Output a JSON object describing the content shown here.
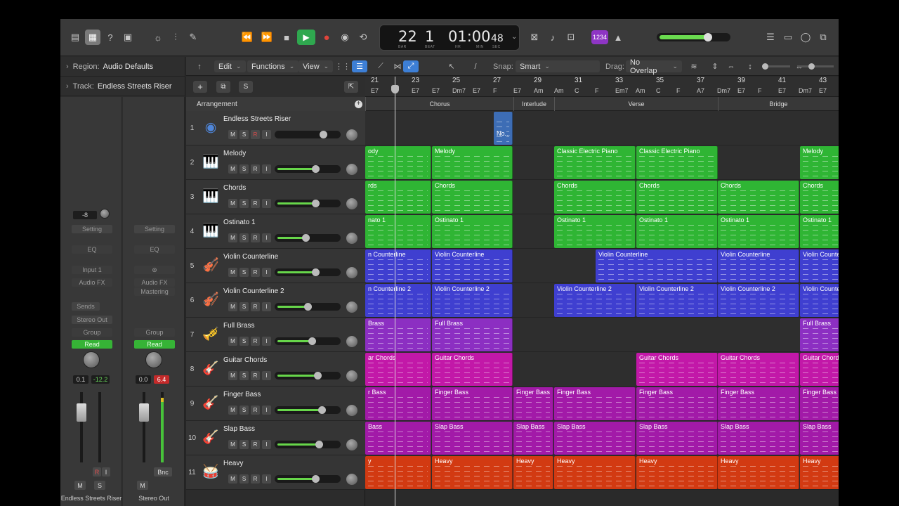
{
  "colors": {
    "green": "#2fb534",
    "blue": "#3f3fd0",
    "purple": "#8c2fc2",
    "magenta": "#c218a8",
    "violet": "#a21aa8",
    "orange": "#d23a12",
    "accent": "#2fa84f"
  },
  "lcd": {
    "bar": "22",
    "beat": "1",
    "time": "01:00",
    "sec": "48",
    "bar_label": "BAR",
    "beat_label": "BEAT",
    "hr": "HR",
    "min": "MIN",
    "sec_label": "SEC"
  },
  "control": {
    "count_in": "1234",
    "rewind_icon": "⏪",
    "ff_icon": "⏩",
    "stop_icon": "■",
    "play_icon": "▶",
    "record_icon": "●",
    "cycle_icon": "⟲"
  },
  "inspector": {
    "region": {
      "label": "Region:",
      "value": "Audio Defaults"
    },
    "track": {
      "label": "Track:",
      "value": "Endless Streets Riser"
    },
    "strip1": {
      "gain": "-8",
      "setting": "Setting",
      "eq": "EQ",
      "input": "Input 1",
      "audio_fx": "Audio FX",
      "sends": "Sends",
      "output": "Stereo Out",
      "group": "Group",
      "read": "Read",
      "vol": "0.1",
      "peak": "-12.2",
      "name": "Endless Streets Riser",
      "m": "M",
      "s": "S",
      "r": "R",
      "i": "I"
    },
    "strip2": {
      "setting": "Setting",
      "eq": "EQ",
      "audio_fx": "Audio FX",
      "mastering": "Mastering",
      "group": "Group",
      "read": "Read",
      "vol": "0.0",
      "peak": "6.4",
      "name": "Stereo Out",
      "m": "M",
      "bnc": "Bnc"
    }
  },
  "toolbar": {
    "edit": "Edit",
    "functions": "Functions",
    "view": "View",
    "snap_label": "Snap:",
    "snap_value": "Smart",
    "drag_label": "Drag:",
    "drag_value": "No Overlap"
  },
  "arrangement_label": "Arrangement",
  "track_buttons": {
    "m": "M",
    "s": "S",
    "r": "R",
    "i": "I"
  },
  "tracks": [
    {
      "num": "1",
      "name": "Endless Streets Riser",
      "icon": "◉",
      "vol": 0.0,
      "armed": true
    },
    {
      "num": "2",
      "name": "Melody",
      "icon": "🎹",
      "vol": 0.66
    },
    {
      "num": "3",
      "name": "Chords",
      "icon": "🎹",
      "vol": 0.66
    },
    {
      "num": "4",
      "name": "Ostinato 1",
      "icon": "🎹",
      "vol": 0.49
    },
    {
      "num": "5",
      "name": "Violin Counterline",
      "icon": "🎻",
      "vol": 0.66
    },
    {
      "num": "6",
      "name": "Violin Counterline 2",
      "icon": "🎻",
      "vol": 0.53
    },
    {
      "num": "7",
      "name": "Full Brass",
      "icon": "🎺",
      "vol": 0.6
    },
    {
      "num": "8",
      "name": "Guitar Chords",
      "icon": "🎸",
      "vol": 0.7
    },
    {
      "num": "9",
      "name": "Finger Bass",
      "icon": "🎸",
      "vol": 0.78
    },
    {
      "num": "10",
      "name": "Slap Bass",
      "icon": "🎸",
      "vol": 0.73
    },
    {
      "num": "11",
      "name": "Heavy",
      "icon": "🥁",
      "vol": 0.66
    }
  ],
  "ruler": {
    "bars": [
      "21",
      "23",
      "25",
      "27",
      "29",
      "31",
      "33",
      "35",
      "37",
      "39",
      "41",
      "43"
    ],
    "chords": [
      "E7",
      "E7",
      "E7",
      "Dm7",
      "E7",
      "F",
      "E7",
      "Am",
      "Am",
      "C",
      "F",
      "Em7",
      "Am",
      "C",
      "F",
      "A7",
      "Dm7",
      "E7",
      "F",
      "E7",
      "Dm7",
      "E7"
    ]
  },
  "markers": [
    "Chorus",
    "Interlude",
    "Verse",
    "Bridge"
  ],
  "regions": [
    {
      "track": 1,
      "name": "No...",
      "kind": "audio"
    },
    {
      "track": 2,
      "name": "ody"
    },
    {
      "track": 2,
      "name": "Melody"
    },
    {
      "track": 2,
      "name": "Classic Electric Piano"
    },
    {
      "track": 2,
      "name": "Classic Electric Piano"
    },
    {
      "track": 2,
      "name": "Melody"
    },
    {
      "track": 3,
      "name": "rds"
    },
    {
      "track": 3,
      "name": "Chords"
    },
    {
      "track": 3,
      "name": "Chords"
    },
    {
      "track": 3,
      "name": "Chords"
    },
    {
      "track": 3,
      "name": "Chords"
    },
    {
      "track": 3,
      "name": "Chords"
    },
    {
      "track": 4,
      "name": "nato 1"
    },
    {
      "track": 4,
      "name": "Ostinato 1"
    },
    {
      "track": 4,
      "name": "Ostinato 1"
    },
    {
      "track": 4,
      "name": "Ostinato 1"
    },
    {
      "track": 4,
      "name": "Ostinato 1"
    },
    {
      "track": 4,
      "name": "Ostinato 1"
    },
    {
      "track": 5,
      "name": "n Counterline"
    },
    {
      "track": 5,
      "name": "Violin Counterline"
    },
    {
      "track": 5,
      "name": "Violin Counterline"
    },
    {
      "track": 5,
      "name": "Violin Counterline"
    },
    {
      "track": 5,
      "name": "Violin Counte"
    },
    {
      "track": 6,
      "name": "n Counterline 2"
    },
    {
      "track": 6,
      "name": "Violin Counterline 2"
    },
    {
      "track": 6,
      "name": "Violin Counterline 2"
    },
    {
      "track": 6,
      "name": "Violin Counterline 2"
    },
    {
      "track": 6,
      "name": "Violin Counterline 2"
    },
    {
      "track": 6,
      "name": "Violin Counte"
    },
    {
      "track": 7,
      "name": "Brass"
    },
    {
      "track": 7,
      "name": "Full Brass"
    },
    {
      "track": 7,
      "name": "Full Brass"
    },
    {
      "track": 8,
      "name": "ar Chords"
    },
    {
      "track": 8,
      "name": "Guitar Chords"
    },
    {
      "track": 8,
      "name": "Guitar Chords"
    },
    {
      "track": 8,
      "name": "Guitar Chords"
    },
    {
      "track": 8,
      "name": "Guitar Chord"
    },
    {
      "track": 9,
      "name": "r Bass"
    },
    {
      "track": 9,
      "name": "Finger Bass"
    },
    {
      "track": 9,
      "name": "Finger Bass"
    },
    {
      "track": 9,
      "name": "Finger Bass"
    },
    {
      "track": 9,
      "name": "Finger Bass"
    },
    {
      "track": 9,
      "name": "Finger Bass"
    },
    {
      "track": 9,
      "name": "Finger Bass"
    },
    {
      "track": 10,
      "name": "Bass"
    },
    {
      "track": 10,
      "name": "Slap Bass"
    },
    {
      "track": 10,
      "name": "Slap Bass"
    },
    {
      "track": 10,
      "name": "Slap Bass"
    },
    {
      "track": 10,
      "name": "Slap Bass"
    },
    {
      "track": 10,
      "name": "Slap Bass"
    },
    {
      "track": 10,
      "name": "Slap Bass"
    },
    {
      "track": 11,
      "name": "y"
    },
    {
      "track": 11,
      "name": "Heavy"
    },
    {
      "track": 11,
      "name": "Heavy"
    },
    {
      "track": 11,
      "name": "Heavy"
    },
    {
      "track": 11,
      "name": "Heavy"
    },
    {
      "track": 11,
      "name": "Heavy"
    },
    {
      "track": 11,
      "name": "Heavy"
    }
  ]
}
